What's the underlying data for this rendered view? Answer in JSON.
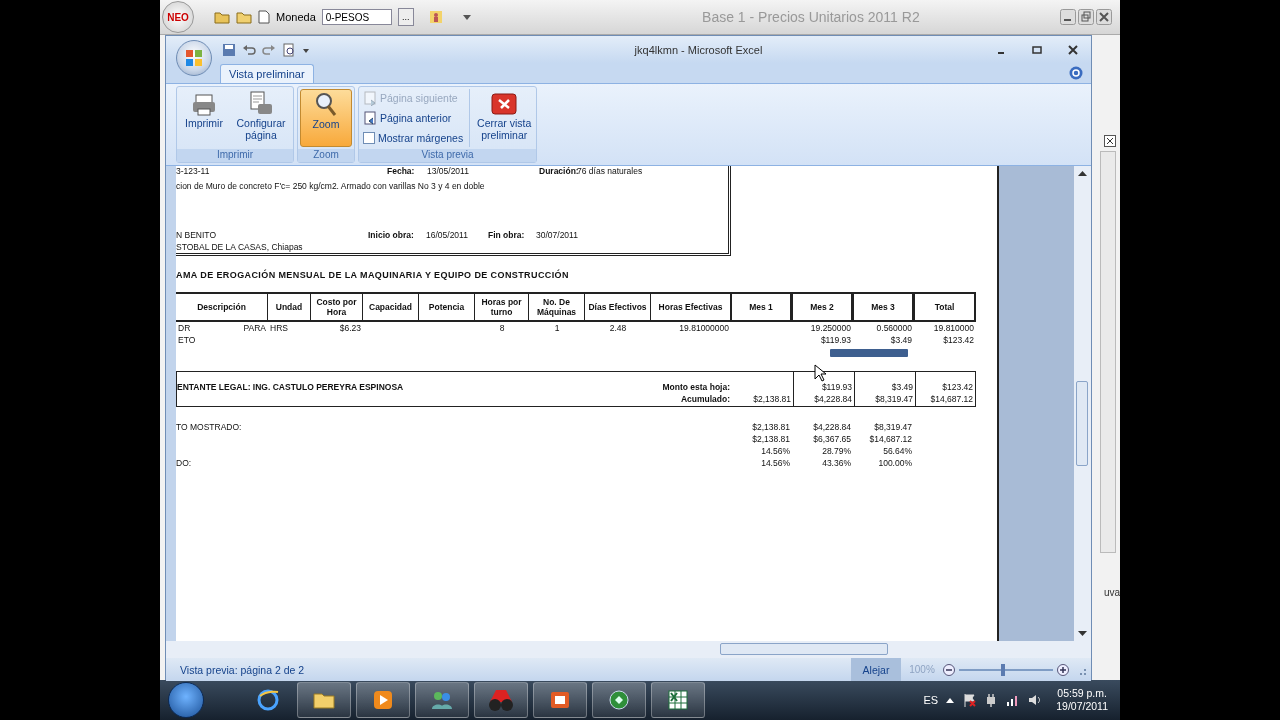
{
  "background_app": {
    "logo": "NEO",
    "currency_label": "Moneda",
    "currency_value": "0-PESOS",
    "browse_button": "...",
    "title": "Base 1 - Precios Unitarios 2011 R2",
    "side_text": "uva"
  },
  "window": {
    "title": "jkq4lkmn - Microsoft Excel"
  },
  "tabs": [
    {
      "label": "Vista preliminar",
      "selected": true
    }
  ],
  "ribbon": {
    "groups": [
      {
        "label": "Imprimir",
        "items": [
          {
            "kind": "large",
            "label": "Imprimir",
            "pressed": false,
            "disabled": false
          },
          {
            "kind": "large",
            "label": "Configurar página",
            "pressed": false,
            "disabled": false
          }
        ]
      },
      {
        "label": "Zoom",
        "items": [
          {
            "kind": "large",
            "label": "Zoom",
            "pressed": true,
            "disabled": false
          }
        ]
      },
      {
        "label": "Vista previa",
        "items": [
          {
            "kind": "small",
            "label": "Página siguiente",
            "disabled": true
          },
          {
            "kind": "small",
            "label": "Página anterior",
            "disabled": false
          },
          {
            "kind": "check",
            "label": "Mostrar márgenes",
            "checked": false,
            "disabled": false
          },
          {
            "kind": "large",
            "label": "Cerrar vista preliminar",
            "pressed": false,
            "disabled": false
          }
        ]
      }
    ]
  },
  "document": {
    "header": {
      "code": "3-123-11",
      "date_label": "Fecha:",
      "date": "13/05/2011",
      "duration_label": "Duración:",
      "duration": "76 días naturales",
      "description": "cion de Muro de concreto F'c= 250 kg/cm2. Armado con varillas No 3 y 4 en doble",
      "place_1": "N BENITO",
      "start_label": "Inicio obra:",
      "start": "16/05/2011",
      "end_label": "Fin obra:",
      "end": "30/07/2011",
      "place_2": "STOBAL DE LA CASAS, Chiapas"
    },
    "title": "AMA DE EROGACIÓN MENSUAL DE LA MAQUINARIA Y EQUIPO DE CONSTRUCCIÓN",
    "table": {
      "columns": [
        "Descripción",
        "Undad",
        "Costo por Hora",
        "Capacidad",
        "Potencia",
        "Horas por turno",
        "No. De Máquinas",
        "Días Efectivos",
        "Horas Efectivas",
        "Mes 1",
        "Mes 2",
        "Mes 3",
        "Total"
      ],
      "rows": [
        {
          "descripcion": "DR",
          "descripcion_2": "PARA",
          "unidad": "HRS",
          "costo_por_hora": "$6.23",
          "horas_por_turno": "8",
          "no_maquinas": "1",
          "dias_efectivos": "2.48",
          "horas_efectivas": "19.81000000",
          "mes_2": "19.250000",
          "mes_3": "0.560000",
          "total": "19.810000"
        },
        {
          "descripcion": "ETO",
          "mes_2": "$119.93",
          "mes_3": "$3.49",
          "total": "$123.42"
        }
      ]
    },
    "legal": "ENTANTE LEGAL: ING. CASTULO PEREYRA ESPINOSA",
    "totals": [
      {
        "label": "Monto esta hoja:",
        "mes_2": "$119.93",
        "mes_3": "$3.49",
        "total": "$123.42"
      },
      {
        "label": "Acumulado:",
        "mes_1": "$2,138.81",
        "mes_2": "$4,228.84",
        "mes_3": "$8,319.47",
        "total": "$14,687.12"
      }
    ],
    "summary": [
      {
        "label": "TO MOSTRADO:",
        "mes_1": "$2,138.81",
        "mes_2": "$4,228.84",
        "mes_3": "$8,319.47"
      },
      {
        "mes_1": "$2,138.81",
        "mes_2": "$6,367.65",
        "mes_3": "$14,687.12"
      },
      {
        "mes_1": "14.56%",
        "mes_2": "28.79%",
        "mes_3": "56.64%"
      },
      {
        "label": "DO:",
        "mes_1": "14.56%",
        "mes_2": "43.36%",
        "mes_3": "100.00%"
      }
    ]
  },
  "status_bar": {
    "text": "Vista previa: página 2 de 2",
    "zoom_out": "Alejar",
    "zoom": "100%",
    "level": 0.45
  },
  "taskbar": {
    "language": "ES",
    "time": "05:59 p.m.",
    "date": "19/07/2011"
  }
}
